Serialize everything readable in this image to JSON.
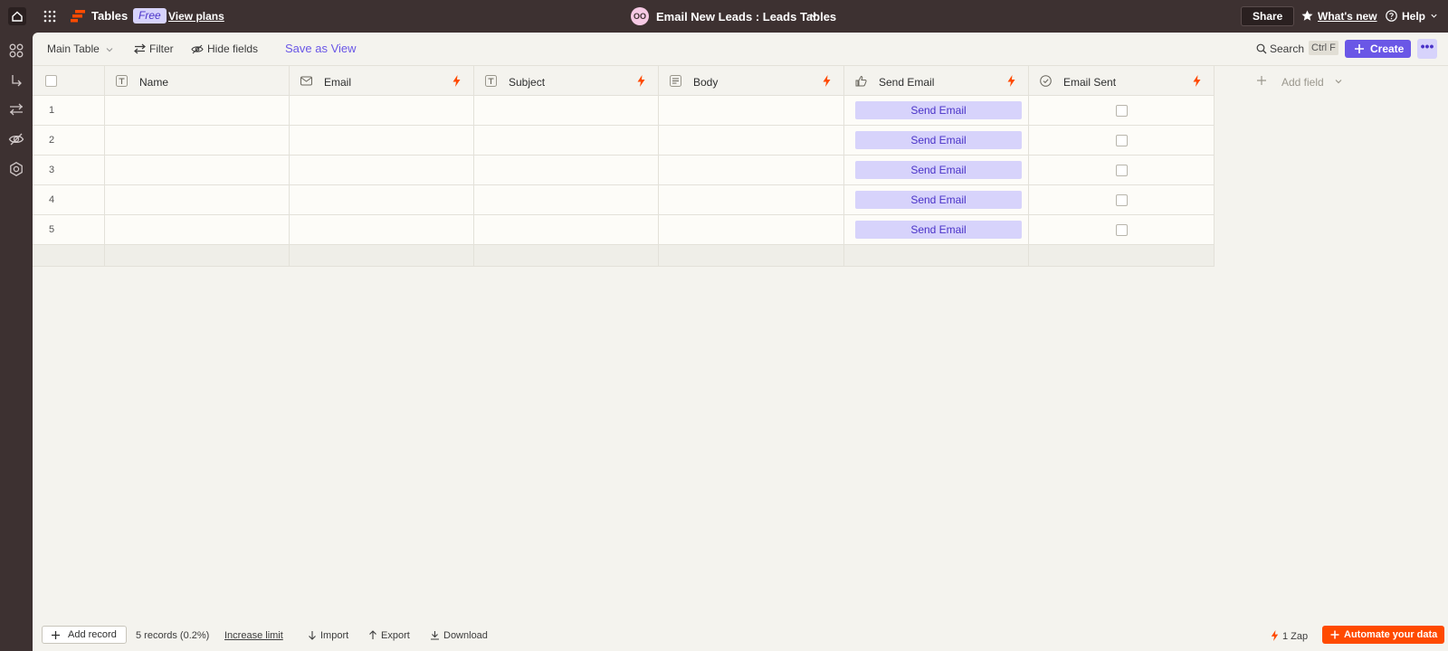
{
  "topbar": {
    "app_name": "Tables",
    "plan_badge": "Free",
    "view_plans": "View plans",
    "avatar_initials": "OO",
    "doc_title": "Email New Leads : Leads Tables",
    "share": "Share",
    "whats_new": "What's new",
    "help": "Help"
  },
  "toolbar": {
    "view_name": "Main Table",
    "filter": "Filter",
    "hide_fields": "Hide fields",
    "save_as_view": "Save as View",
    "search": "Search",
    "shortcut": "Ctrl F",
    "create": "Create",
    "more": "•••"
  },
  "columns": [
    {
      "label": "Name",
      "type_icon": "text-type-icon"
    },
    {
      "label": "Email",
      "type_icon": "email-type-icon",
      "automation": true
    },
    {
      "label": "Subject",
      "type_icon": "text-type-icon",
      "automation": true
    },
    {
      "label": "Body",
      "type_icon": "long-text-type-icon",
      "automation": true
    },
    {
      "label": "Send Email",
      "type_icon": "button-type-icon",
      "automation": true
    },
    {
      "label": "Email Sent",
      "type_icon": "checkbox-type-icon",
      "automation": true
    }
  ],
  "add_field": "Add field",
  "rows": [
    {
      "num": "1",
      "button": "Send Email",
      "sent": false
    },
    {
      "num": "2",
      "button": "Send Email",
      "sent": false
    },
    {
      "num": "3",
      "button": "Send Email",
      "sent": false
    },
    {
      "num": "4",
      "button": "Send Email",
      "sent": false
    },
    {
      "num": "5",
      "button": "Send Email",
      "sent": false
    }
  ],
  "bottombar": {
    "add_record": "Add record",
    "records_count": "5 records (0.2%)",
    "increase_limit": "Increase limit",
    "import": "Import",
    "export": "Export",
    "download": "Download",
    "zaps": "1 Zap",
    "automate": "Automate your data"
  },
  "colors": {
    "accent": "#6a57e6",
    "button_bg": "#d7d3fb",
    "automation_orange": "#ff4a00",
    "topbar": "#3d3131"
  }
}
